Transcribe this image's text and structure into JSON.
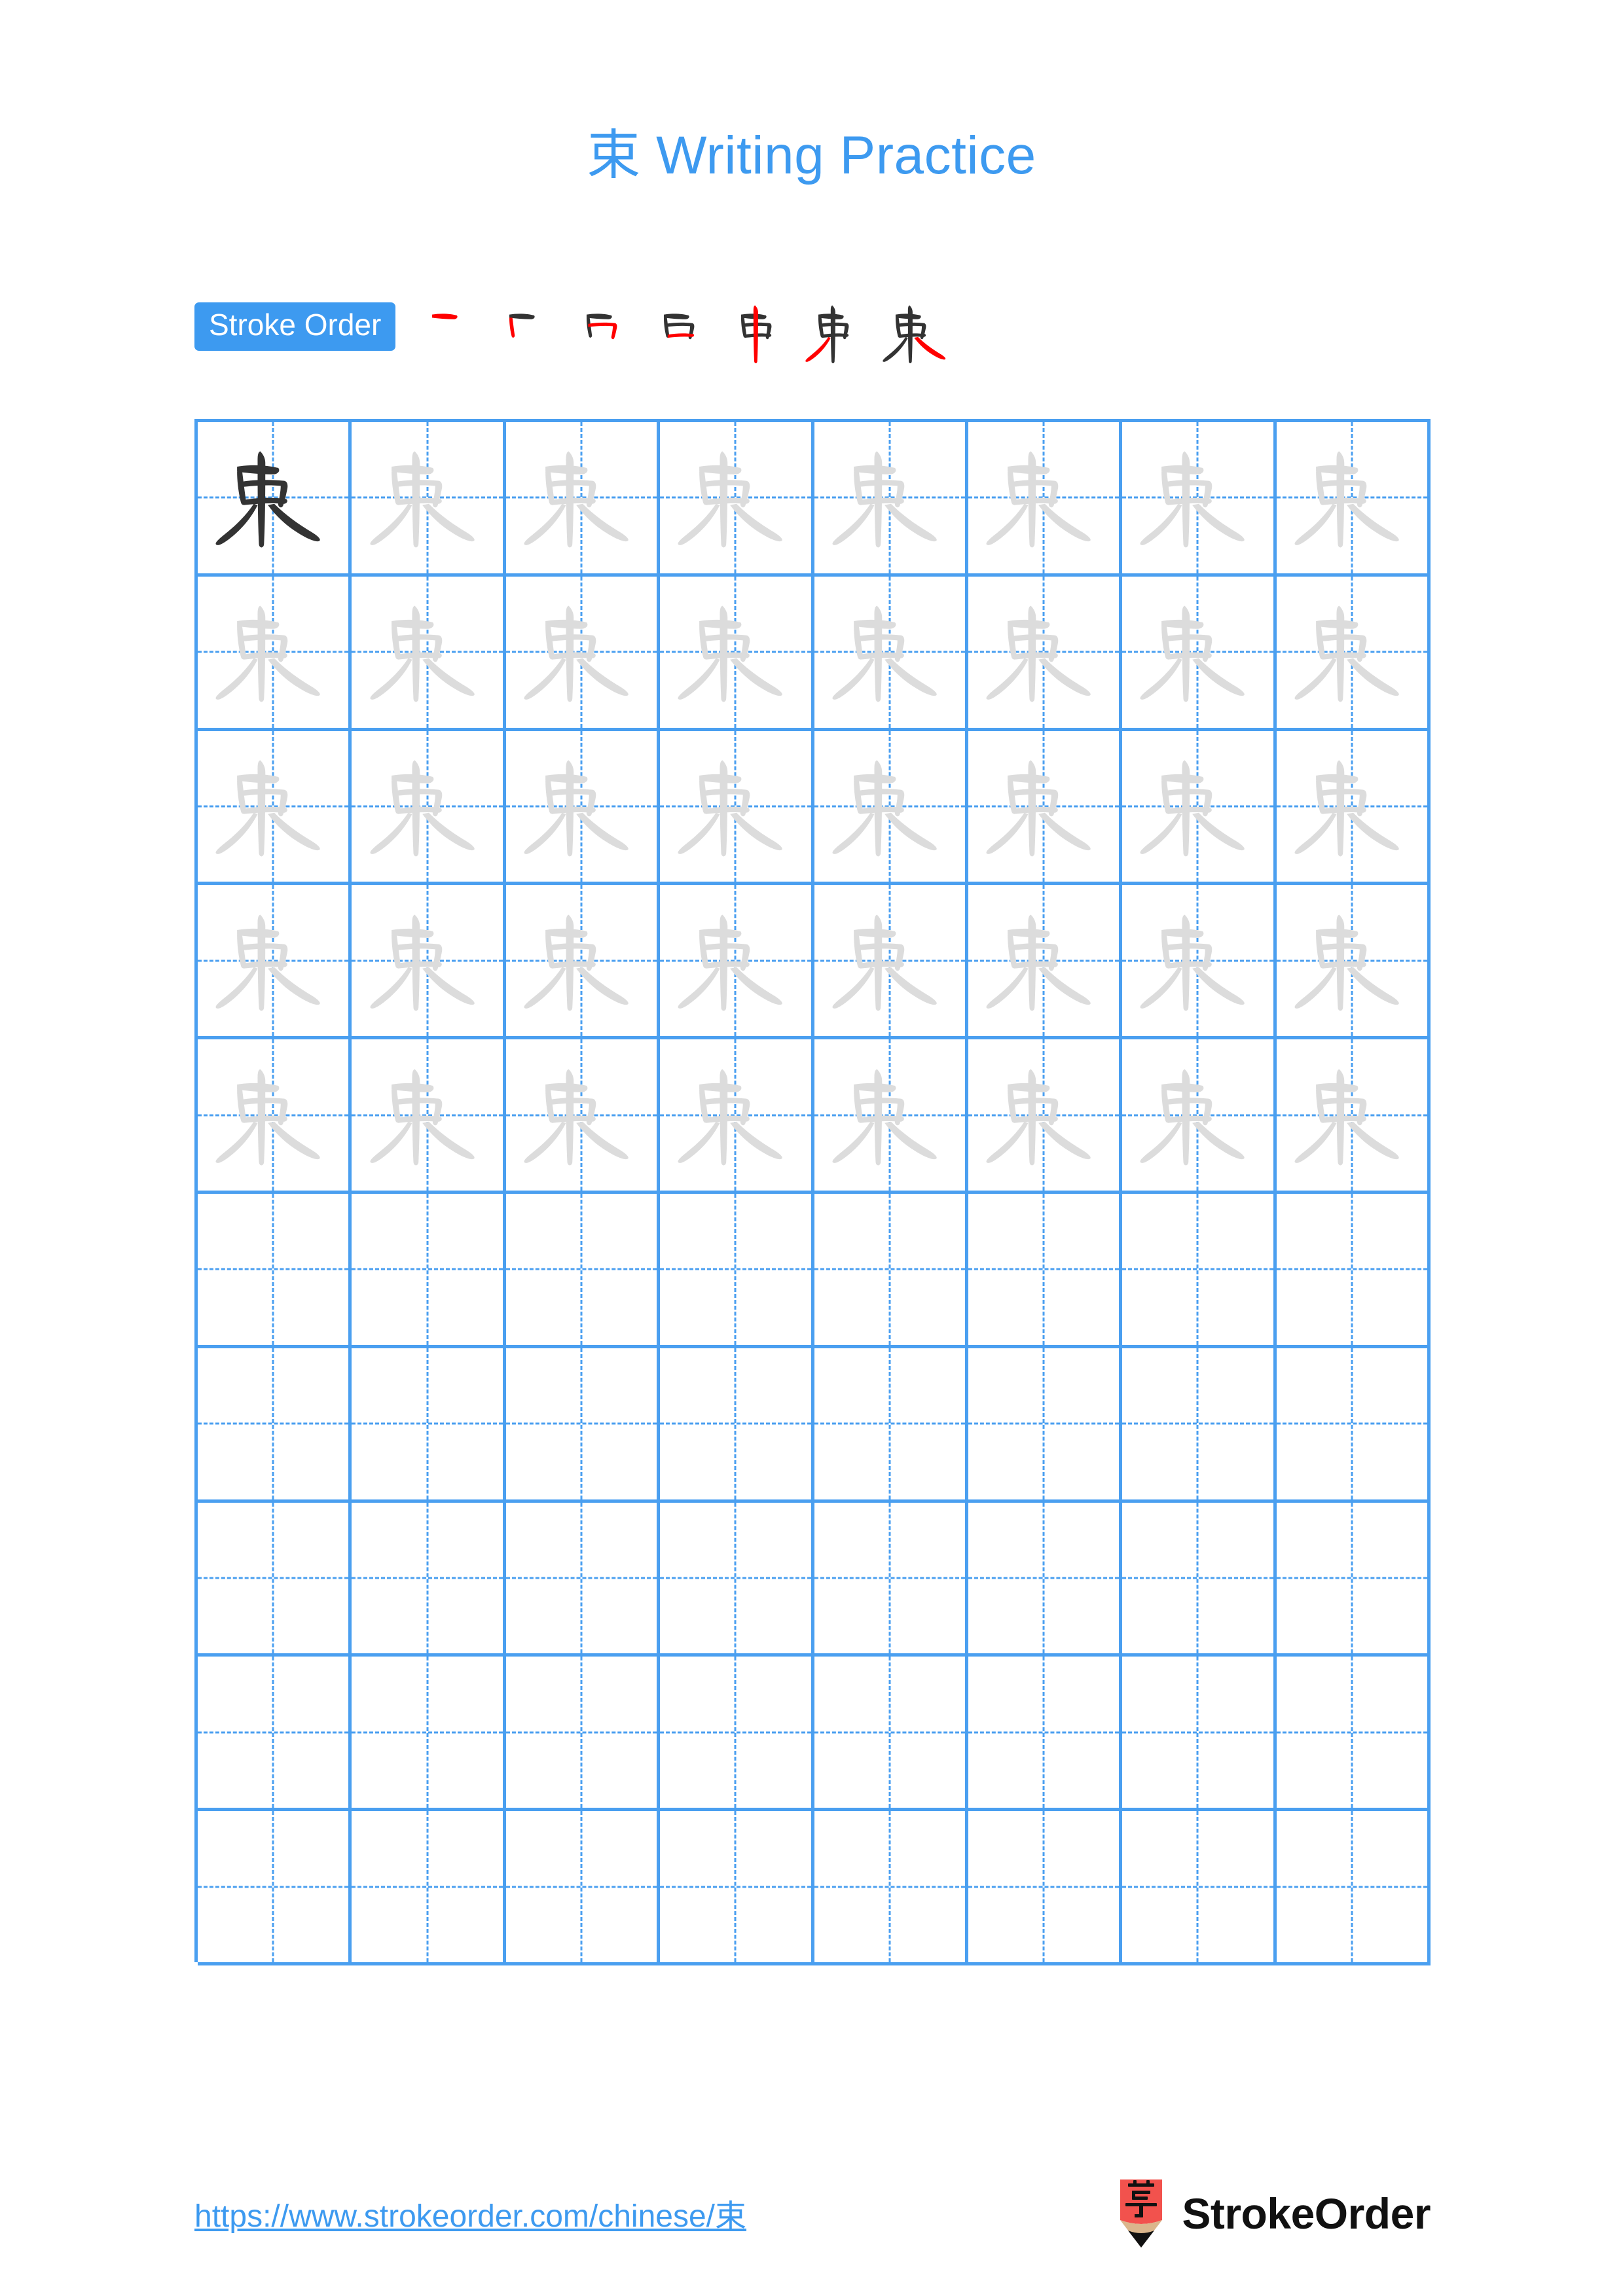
{
  "document": {
    "character": "束",
    "title": "束 Writing Practice",
    "title_character": "束",
    "title_text": " Writing Practice",
    "page_background": "#FFFFFF"
  },
  "colors": {
    "accent_blue": "#3D9AF0",
    "grid_blue": "#4A9FF0",
    "stroke_new": "#FF0000",
    "stroke_done": "#333333",
    "trace_gray": "#DCDCDC",
    "logo_red": "#F2524D",
    "logo_wood": "#DBB68C"
  },
  "stroke_order": {
    "badge_label": "Stroke Order",
    "total_strokes": 7,
    "steps": [
      {
        "index": 1,
        "name": "stroke-step-1",
        "new_stroke": "heng"
      },
      {
        "index": 2,
        "name": "stroke-step-2",
        "new_stroke": "shu"
      },
      {
        "index": 3,
        "name": "stroke-step-3",
        "new_stroke": "hengzhegou"
      },
      {
        "index": 4,
        "name": "stroke-step-4",
        "new_stroke": "heng"
      },
      {
        "index": 5,
        "name": "stroke-step-5",
        "new_stroke": "shu"
      },
      {
        "index": 6,
        "name": "stroke-step-6",
        "new_stroke": "pie"
      },
      {
        "index": 7,
        "name": "stroke-step-7",
        "new_stroke": "na"
      }
    ]
  },
  "grid": {
    "columns": 8,
    "rows": 10,
    "traced_rows": 5,
    "blank_rows": 5,
    "first_cell_style": "dark",
    "trace_cell_style": "light",
    "guide_lines": "dashed-crosshair"
  },
  "footer": {
    "url": "https://www.strokeorder.com/chinese/束",
    "brand_name": "StrokeOrder",
    "logo_character": "字",
    "logo_icon": "pencil-logo-icon"
  }
}
